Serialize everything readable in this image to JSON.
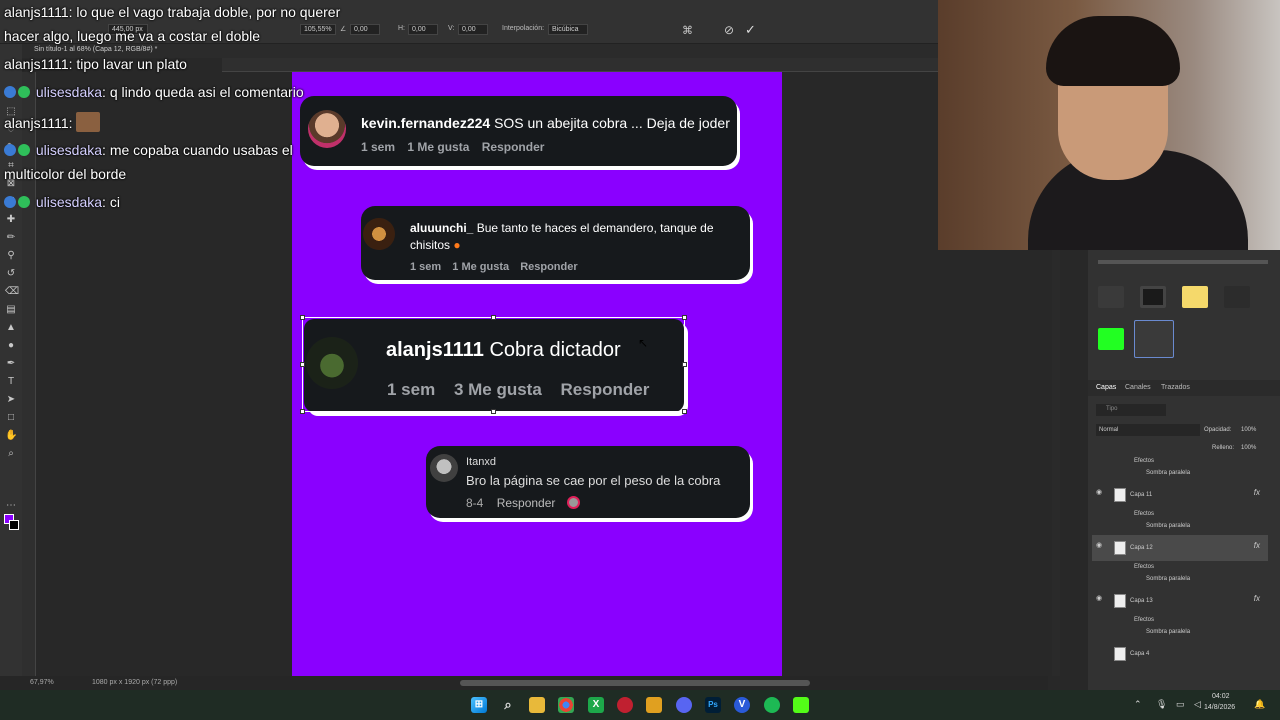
{
  "photoshop": {
    "doc_tab": "Sin título-1 al 68% (Capa 12, RGB/8#) *",
    "options": {
      "pos_x": "445,00 px",
      "w_pct": "105,55%",
      "angle": "0,00",
      "h_val": "0,00",
      "v_val": "0,00",
      "interp_label": "Interpolación:",
      "interp_value": "Bicúbica"
    },
    "status": {
      "zoom": "67,97%",
      "doc_info": "1080 px x 1920 px (72 ppp)"
    }
  },
  "comments": [
    {
      "user": "kevin.fernandez224",
      "text": "SOS un abejita cobra ... Deja de joder",
      "time": "1 sem",
      "likes": "1 Me gusta",
      "reply": "Responder"
    },
    {
      "user": "aluuunchi_",
      "text": "Bue tanto te haces el demandero, tanque de chisitos",
      "time": "1 sem",
      "likes": "1 Me gusta",
      "reply": "Responder"
    },
    {
      "user": "alanjs1111",
      "text": "Cobra dictador",
      "time": "1 sem",
      "likes": "3 Me gusta",
      "reply": "Responder"
    },
    {
      "user": "Itanxd",
      "text": "Bro la página se cae por el peso de la cobra",
      "time": "8-4",
      "reply": "Responder"
    }
  ],
  "chat": [
    {
      "user": "alanjs1111",
      "text": "lo que el vago trabaja doble, por no querer"
    },
    {
      "user": "",
      "text": "hacer algo, luego me va a costar el doble"
    },
    {
      "user": "alanjs1111",
      "text": "tipo lavar un plato"
    },
    {
      "user": "ulisesdaka",
      "text": "q lindo queda asi el comentario"
    },
    {
      "user": "alanjs1111",
      "text": ""
    },
    {
      "user": "ulisesdaka",
      "text": "me copaba cuando usabas el"
    },
    {
      "user": "",
      "text": "multicolor del borde"
    },
    {
      "user": "ulisesdaka",
      "text": "ci"
    }
  ],
  "layers_panel": {
    "tabs": [
      "Capas",
      "Canales",
      "Trazados"
    ],
    "search_placeholder": "Tipo",
    "blend_mode": "Normal",
    "opacity_label": "Opacidad:",
    "opacity_value": "100%",
    "fill_label": "Relleno:",
    "fill_value": "100%",
    "effects_label": "Efectos",
    "shadow_label": "Sombra paralela",
    "layers": [
      "Capa 11",
      "Capa 12",
      "Capa 13",
      "Capa 4"
    ]
  },
  "taskbar": {
    "time": "04:02",
    "date": "14/8/2026"
  },
  "colors": {
    "artboard": "#8a00ff",
    "card": "#16191c",
    "swatch_green": "#22ff22",
    "swatch_yellow": "#f5d96b"
  }
}
